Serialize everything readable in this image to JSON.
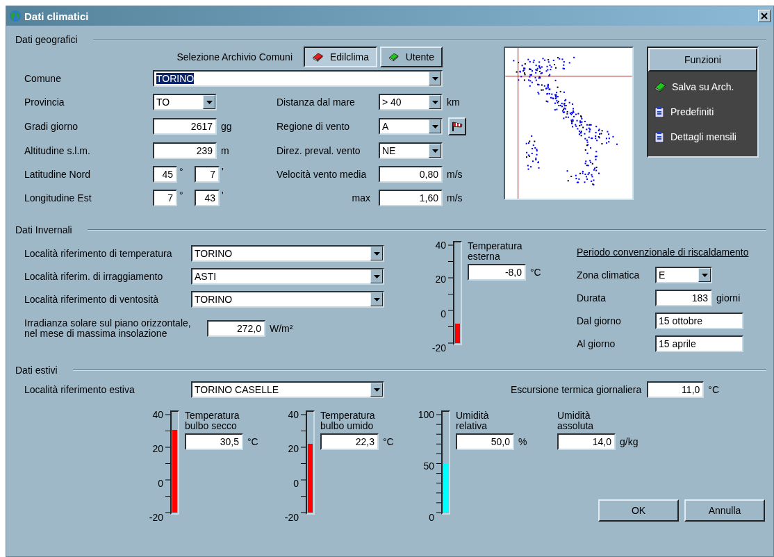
{
  "window": {
    "title": "Dati climatici"
  },
  "geo": {
    "title": "Dati geografici",
    "archive": {
      "label": "Selezione Archivio Comuni",
      "options": [
        {
          "label": "Edilclima",
          "selected": true
        },
        {
          "label": "Utente",
          "selected": false
        }
      ]
    },
    "comune": {
      "label": "Comune",
      "value": "TORINO",
      "text_selected": true
    },
    "rows": [
      {
        "left": {
          "label": "Provincia",
          "kind": "combo",
          "value": "TO"
        },
        "right": {
          "label": "Distanza dal mare",
          "kind": "combo",
          "value": "> 40",
          "unit": "km"
        }
      },
      {
        "left": {
          "label": "Gradi giorno",
          "kind": "number",
          "value": "2617",
          "unit": "gg"
        },
        "right": {
          "label": "Regione di vento",
          "kind": "combo",
          "value": "A",
          "map_button": true
        }
      },
      {
        "left": {
          "label": "Altitudine s.l.m.",
          "kind": "number",
          "value": "239",
          "unit": "m"
        },
        "right": {
          "label": "Direz. preval. vento",
          "kind": "combo",
          "value": "NE"
        }
      },
      {
        "left": {
          "label": "Latitudine Nord",
          "kind": "angle",
          "degrees": "45",
          "degree_sign": "°",
          "minutes": "7",
          "minute_sign": "'"
        },
        "right": {
          "label": "Velocità vento media",
          "kind": "number",
          "value": "0,80",
          "unit": "m/s"
        }
      },
      {
        "left": {
          "label": "Longitudine Est",
          "kind": "angle",
          "degrees": "7",
          "degree_sign": "°",
          "minutes": "43",
          "minute_sign": "'"
        },
        "right": {
          "label": "max",
          "kind": "number",
          "value": "1,60",
          "unit": "m/s"
        }
      }
    ],
    "functions": {
      "title": "Funzioni",
      "items": [
        "Salva su Arch.",
        "Predefiniti",
        "Dettagli mensili"
      ]
    }
  },
  "winter": {
    "title": "Dati Invernali",
    "localities": [
      {
        "label": "Località riferimento di temperatura",
        "value": "TORINO"
      },
      {
        "label": "Località riferim. di irraggiamento",
        "value": "ASTI"
      },
      {
        "label": "Località riferimento di ventosità",
        "value": "TORINO"
      }
    ],
    "irradiance": {
      "label": "Irradianza solare sul piano orizzontale,\nnel mese di massima insolazione",
      "value": "272,0",
      "unit": "W/m²"
    },
    "outdoor": {
      "label": "Temperatura\nesterna",
      "value": "-8,0",
      "unit": "°C",
      "level": 0.2,
      "color": "#ff0000",
      "scale": [
        "40",
        "20",
        "0",
        "-20"
      ]
    },
    "period": {
      "title": "Periodo convenzionale di riscaldamento",
      "rows": [
        {
          "label": "Zona climatica",
          "kind": "combo",
          "value": "E"
        },
        {
          "label": "Durata",
          "kind": "number",
          "value": "183",
          "unit": "giorni"
        },
        {
          "label": "Dal giorno",
          "kind": "text",
          "value": "15 ottobre"
        },
        {
          "label": "Al giorno",
          "kind": "text",
          "value": "15 aprile"
        }
      ]
    }
  },
  "summer": {
    "title": "Dati estivi",
    "locality": {
      "label": "Località riferimento estiva",
      "value": "TORINO CASELLE"
    },
    "excursion": {
      "label": "Escursione termica giornaliera",
      "value": "11,0",
      "unit": "°C"
    },
    "gauges": [
      {
        "label": "Temperatura\nbulbo secco",
        "value": "30,5",
        "unit": "°C",
        "level": 0.842,
        "color": "#ff0000",
        "scale": [
          "40",
          "20",
          "0",
          "-20"
        ]
      },
      {
        "label": "Temperatura\nbulbo umido",
        "value": "22,3",
        "unit": "°C",
        "level": 0.705,
        "color": "#ff0000",
        "scale": [
          "40",
          "20",
          "0",
          "-20"
        ]
      },
      {
        "label": "Umidità\nrelativa",
        "value": "50,0",
        "unit": "%",
        "level": 0.5,
        "color": "#00ffff",
        "scale": [
          "100",
          "50",
          "0"
        ]
      }
    ],
    "absolute": {
      "label": "Umidità\nassoluta",
      "value": "14,0",
      "unit": "g/kg"
    }
  },
  "buttons": [
    "OK",
    "Annulla"
  ]
}
